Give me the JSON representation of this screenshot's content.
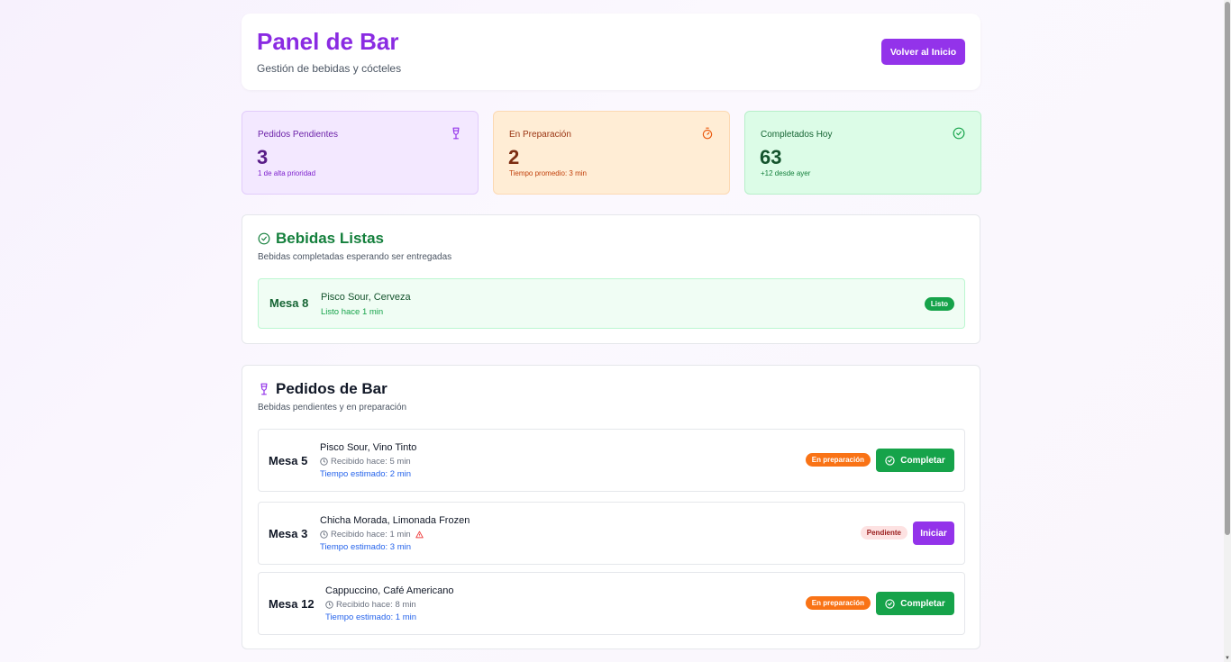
{
  "header": {
    "title": "Panel de Bar",
    "subtitle": "Gestión de bebidas y cócteles",
    "home_button": "Volver al Inicio"
  },
  "stats": {
    "pending": {
      "label": "Pedidos Pendientes",
      "value": "3",
      "note": "1 de alta prioridad",
      "icon": "wine-glass-icon"
    },
    "preparing": {
      "label": "En Preparación",
      "value": "2",
      "note": "Tiempo promedio: 3 min",
      "icon": "timer-icon"
    },
    "completed": {
      "label": "Completados Hoy",
      "value": "63",
      "note": "+12 desde ayer",
      "icon": "check-circle-icon"
    }
  },
  "ready_section": {
    "title": "Bebidas Listas",
    "description": "Bebidas completadas esperando ser entregadas",
    "items": [
      {
        "mesa": "Mesa 8",
        "drinks": "Pisco Sour, Cerveza",
        "time": "Listo hace 1 min",
        "badge": "Listo"
      }
    ]
  },
  "orders_section": {
    "title": "Pedidos de Bar",
    "description": "Bebidas pendientes y en preparación",
    "orders": [
      {
        "mesa": "Mesa 5",
        "drinks": "Pisco Sour, Vino Tinto",
        "received": "Recibido hace: 5 min",
        "estimated": "Tiempo estimado: 2 min",
        "status": "En preparación",
        "action": "Completar",
        "alert": false
      },
      {
        "mesa": "Mesa 3",
        "drinks": "Chicha Morada, Limonada Frozen",
        "received": "Recibido hace: 1 min",
        "estimated": "Tiempo estimado: 3 min",
        "status": "Pendiente",
        "action": "Iniciar",
        "alert": true
      },
      {
        "mesa": "Mesa 12",
        "drinks": "Cappuccino, Café Americano",
        "received": "Recibido hace: 8 min",
        "estimated": "Tiempo estimado: 1 min",
        "status": "En preparación",
        "action": "Completar",
        "alert": false
      }
    ]
  },
  "colors": {
    "brand_purple": "#9333ea",
    "success_green": "#16a34a",
    "warning_orange": "#f97316"
  }
}
